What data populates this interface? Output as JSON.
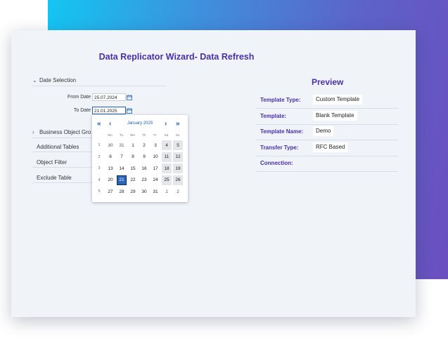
{
  "wizard": {
    "title": "Data Replicator Wizard- Data Refresh",
    "date_selection": "Date Selection",
    "from_date_label": "From Date",
    "from_date_value": "25.07.2024",
    "to_date_label": "To Date",
    "to_date_value": "21.01.2025",
    "business_object_group": "Business Object Gro",
    "items": [
      "Additional Tables",
      "Object Filter",
      "Exclude Table"
    ]
  },
  "calendar": {
    "month": "January 2025",
    "weekdays": [
      "Mo",
      "Tu",
      "We",
      "Th",
      "Fr",
      "Sa",
      "Su"
    ],
    "weeks": [
      {
        "num": "1",
        "days": [
          "30",
          "31",
          "1",
          "2",
          "3",
          "4",
          "5"
        ]
      },
      {
        "num": "2",
        "days": [
          "6",
          "7",
          "8",
          "9",
          "10",
          "11",
          "12"
        ]
      },
      {
        "num": "3",
        "days": [
          "13",
          "14",
          "15",
          "16",
          "17",
          "18",
          "19"
        ]
      },
      {
        "num": "4",
        "days": [
          "20",
          "21",
          "22",
          "23",
          "24",
          "25",
          "26"
        ]
      },
      {
        "num": "5",
        "days": [
          "27",
          "28",
          "29",
          "30",
          "31",
          "1",
          "2"
        ]
      }
    ],
    "selected": "21",
    "icons": {
      "prev_year": "double-chevron-left-icon",
      "prev_month": "chevron-left-icon",
      "next_month": "chevron-right-icon",
      "next_year": "double-chevron-right-icon"
    }
  },
  "preview": {
    "title": "Preview",
    "rows": [
      {
        "label": "Template Type:",
        "value": "Custom Template"
      },
      {
        "label": "Template:",
        "value": "Blank Template"
      },
      {
        "label": "Template Name:",
        "value": "Demo"
      },
      {
        "label": "Transfer Type:",
        "value": "RFC Based"
      },
      {
        "label": "Connection:",
        "value": ""
      }
    ]
  },
  "colors": {
    "accent": "#4a2fa8",
    "selected_day": "#2a63b7",
    "link": "#1a5fb4"
  }
}
